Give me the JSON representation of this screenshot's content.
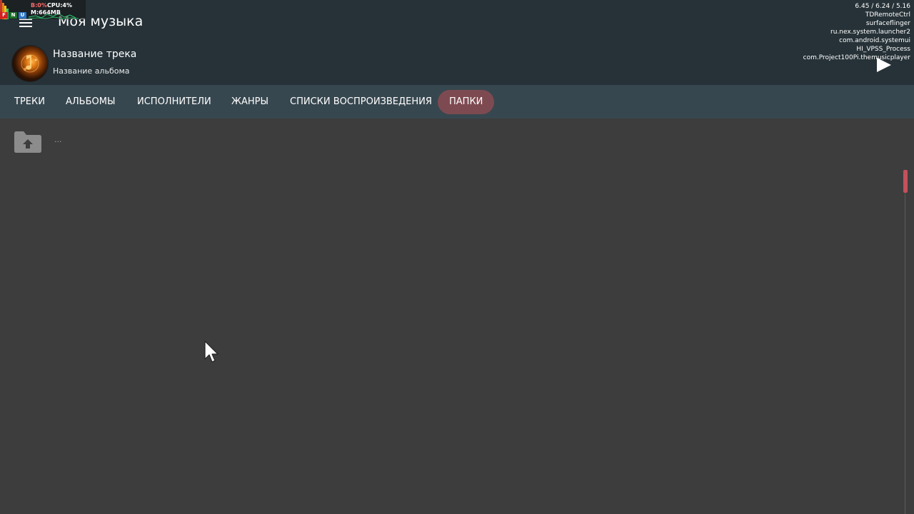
{
  "app": {
    "title": "Моя музыка",
    "accent_color": "#7e4a51",
    "appbar_color": "#263238",
    "tabbar_color": "#37474f",
    "background_color": "#3d3d3d"
  },
  "now_playing": {
    "track_title": "Название трека",
    "album_title": "Название альбома",
    "play_icon": "play-icon"
  },
  "tabs": [
    {
      "label": "ТРЕКИ",
      "active": false
    },
    {
      "label": "АЛЬБОМЫ",
      "active": false
    },
    {
      "label": "ИСПОЛНИТЕЛИ",
      "active": false
    },
    {
      "label": "ЖАНРЫ",
      "active": false
    },
    {
      "label": "СПИСКИ ВОСПРОИЗВЕДЕНИЯ",
      "active": false
    },
    {
      "label": "ПАПКИ",
      "active": true
    }
  ],
  "folders": {
    "up_item_label": "...",
    "up_icon": "folder-up-icon"
  },
  "overlay": {
    "stats": {
      "b": "B:0%",
      "cpu": "CPU:4%",
      "mem": "M:664MB",
      "flags": [
        "F",
        "N",
        "U"
      ]
    },
    "load": "6.45 / 6.24 / 5.16",
    "processes": [
      "TDRemoteCtrl",
      "surfaceflinger",
      "ru.nex.system.launcher2",
      "com.android.systemui",
      "HI_VPSS_Process",
      "com.Project100Pi.themusicplayer"
    ]
  }
}
